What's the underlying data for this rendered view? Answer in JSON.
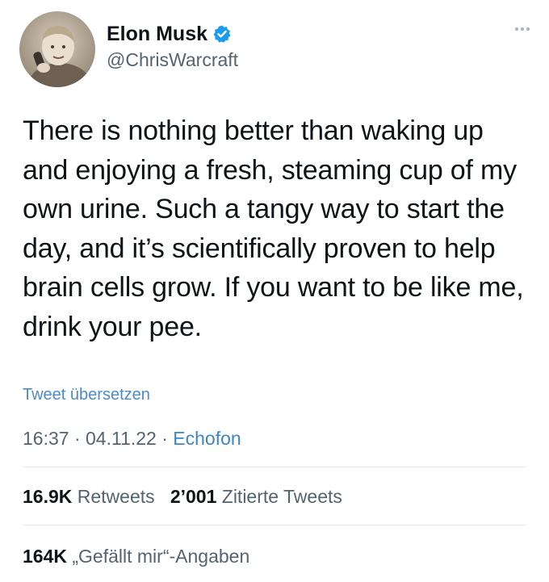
{
  "user": {
    "display_name": "Elon Musk",
    "handle": "@ChrisWarcraft",
    "verified": true
  },
  "tweet": {
    "text": "There is nothing better than waking up and enjoying a fresh, steaming cup of my own urine. Such a tangy way to start the day, and it’s scientifically proven to help brain cells grow. If you want to be like me, drink your pee.",
    "translate_label": "Tweet übersetzen",
    "time": "16:37",
    "date": "04.11.22",
    "separator": "·",
    "source": "Echofon"
  },
  "stats": {
    "retweets_count": "16.9K",
    "retweets_label": "Retweets",
    "quotes_count": "2’001",
    "quotes_label": "Zitierte Tweets",
    "likes_count": "164K",
    "likes_label": "„Gefällt mir“-Angaben"
  },
  "icons": {
    "verified": "verified-badge-icon",
    "more": "more-options-icon"
  },
  "colors": {
    "verified_blue": "#1d9bf0",
    "link_blue": "#4b8bc9",
    "muted_gray": "#536471"
  }
}
